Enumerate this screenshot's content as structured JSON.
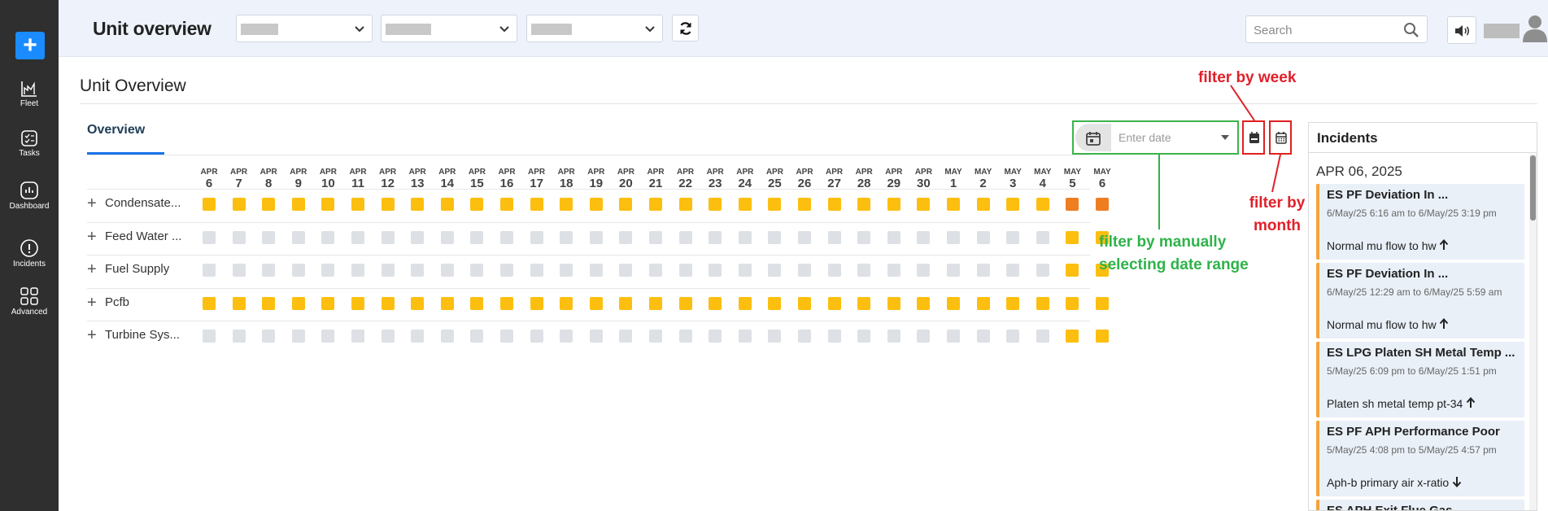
{
  "header": {
    "app_title": "Unit overview",
    "search_placeholder": "Search"
  },
  "sidebar": {
    "items": [
      {
        "label": "Fleet",
        "icon": "fleet-chart-icon"
      },
      {
        "label": "Tasks",
        "icon": "tasks-icon"
      },
      {
        "label": "Dashboard",
        "icon": "dashboard-icon"
      },
      {
        "label": "Incidents",
        "icon": "incidents-icon"
      },
      {
        "label": "Advanced",
        "icon": "advanced-grid-icon"
      }
    ]
  },
  "page": {
    "title": "Unit Overview",
    "tab_label": "Overview",
    "date_placeholder": "Enter date"
  },
  "heatmap": {
    "dates": [
      {
        "month": "APR",
        "day": "6"
      },
      {
        "month": "APR",
        "day": "7"
      },
      {
        "month": "APR",
        "day": "8"
      },
      {
        "month": "APR",
        "day": "9"
      },
      {
        "month": "APR",
        "day": "10"
      },
      {
        "month": "APR",
        "day": "11"
      },
      {
        "month": "APR",
        "day": "12"
      },
      {
        "month": "APR",
        "day": "13"
      },
      {
        "month": "APR",
        "day": "14"
      },
      {
        "month": "APR",
        "day": "15"
      },
      {
        "month": "APR",
        "day": "16"
      },
      {
        "month": "APR",
        "day": "17"
      },
      {
        "month": "APR",
        "day": "18"
      },
      {
        "month": "APR",
        "day": "19"
      },
      {
        "month": "APR",
        "day": "20"
      },
      {
        "month": "APR",
        "day": "21"
      },
      {
        "month": "APR",
        "day": "22"
      },
      {
        "month": "APR",
        "day": "23"
      },
      {
        "month": "APR",
        "day": "24"
      },
      {
        "month": "APR",
        "day": "25"
      },
      {
        "month": "APR",
        "day": "26"
      },
      {
        "month": "APR",
        "day": "27"
      },
      {
        "month": "APR",
        "day": "28"
      },
      {
        "month": "APR",
        "day": "29"
      },
      {
        "month": "APR",
        "day": "30"
      },
      {
        "month": "MAY",
        "day": "1"
      },
      {
        "month": "MAY",
        "day": "2"
      },
      {
        "month": "MAY",
        "day": "3"
      },
      {
        "month": "MAY",
        "day": "4"
      },
      {
        "month": "MAY",
        "day": "5"
      },
      {
        "month": "MAY",
        "day": "6"
      }
    ],
    "status_colors": {
      "warn": "#fcbf0f",
      "alert": "#ef7d22",
      "none": "#dde0e5"
    },
    "rows": [
      {
        "label": "Condensate...",
        "cells": [
          "warn",
          "warn",
          "warn",
          "warn",
          "warn",
          "warn",
          "warn",
          "warn",
          "warn",
          "warn",
          "warn",
          "warn",
          "warn",
          "warn",
          "warn",
          "warn",
          "warn",
          "warn",
          "warn",
          "warn",
          "warn",
          "warn",
          "warn",
          "warn",
          "warn",
          "warn",
          "warn",
          "warn",
          "warn",
          "alert",
          "alert"
        ]
      },
      {
        "label": "Feed Water ...",
        "cells": [
          "none",
          "none",
          "none",
          "none",
          "none",
          "none",
          "none",
          "none",
          "none",
          "none",
          "none",
          "none",
          "none",
          "none",
          "none",
          "none",
          "none",
          "none",
          "none",
          "none",
          "none",
          "none",
          "none",
          "none",
          "none",
          "none",
          "none",
          "none",
          "none",
          "warn",
          "warn"
        ]
      },
      {
        "label": "Fuel Supply",
        "cells": [
          "none",
          "none",
          "none",
          "none",
          "none",
          "none",
          "none",
          "none",
          "none",
          "none",
          "none",
          "none",
          "none",
          "none",
          "none",
          "none",
          "none",
          "none",
          "none",
          "none",
          "none",
          "none",
          "none",
          "none",
          "none",
          "none",
          "none",
          "none",
          "none",
          "warn",
          "warn"
        ]
      },
      {
        "label": "Pcfb",
        "cells": [
          "warn",
          "warn",
          "warn",
          "warn",
          "warn",
          "warn",
          "warn",
          "warn",
          "warn",
          "warn",
          "warn",
          "warn",
          "warn",
          "warn",
          "warn",
          "warn",
          "warn",
          "warn",
          "warn",
          "warn",
          "warn",
          "warn",
          "warn",
          "warn",
          "warn",
          "warn",
          "warn",
          "warn",
          "warn",
          "warn",
          "warn"
        ]
      },
      {
        "label": "Turbine Sys...",
        "cells": [
          "none",
          "none",
          "none",
          "none",
          "none",
          "none",
          "none",
          "none",
          "none",
          "none",
          "none",
          "none",
          "none",
          "none",
          "none",
          "none",
          "none",
          "none",
          "none",
          "none",
          "none",
          "none",
          "none",
          "none",
          "none",
          "none",
          "none",
          "none",
          "none",
          "warn",
          "warn"
        ]
      }
    ]
  },
  "annotations": {
    "week": "filter by week",
    "month_line1": "filter by",
    "month_line2": "month",
    "range_line1": "filter by manually",
    "range_line2": "selecting date range"
  },
  "incidents": {
    "title": "Incidents",
    "date_group": "APR 06, 2025",
    "items": [
      {
        "title": "ES PF Deviation In ...",
        "time": "6/May/25 6:16 am to 6/May/25 3:19 pm",
        "desc": "Normal mu flow to hw",
        "trend": "up"
      },
      {
        "title": "ES PF Deviation In ...",
        "time": "6/May/25 12:29 am to 6/May/25 5:59 am",
        "desc": "Normal mu flow to hw",
        "trend": "up"
      },
      {
        "title": "ES LPG Platen SH Metal Temp ...",
        "time": "5/May/25 6:09 pm to 6/May/25 1:51 pm",
        "desc": "Platen sh metal temp pt-34",
        "trend": "up"
      },
      {
        "title": "ES PF APH Performance Poor",
        "time": "5/May/25 4:08 pm to 5/May/25 4:57 pm",
        "desc": "Aph-b primary air x-ratio",
        "trend": "down"
      },
      {
        "title": "ES APH Exit Flue Gas",
        "time": "",
        "desc": "",
        "trend": ""
      }
    ]
  },
  "colors": {
    "sidebar": "#2f2f2f",
    "accent": "#1a8cff",
    "annotation_red": "#e0202a",
    "annotation_green": "#2eb34a",
    "incident_border": "#f5a43c"
  }
}
